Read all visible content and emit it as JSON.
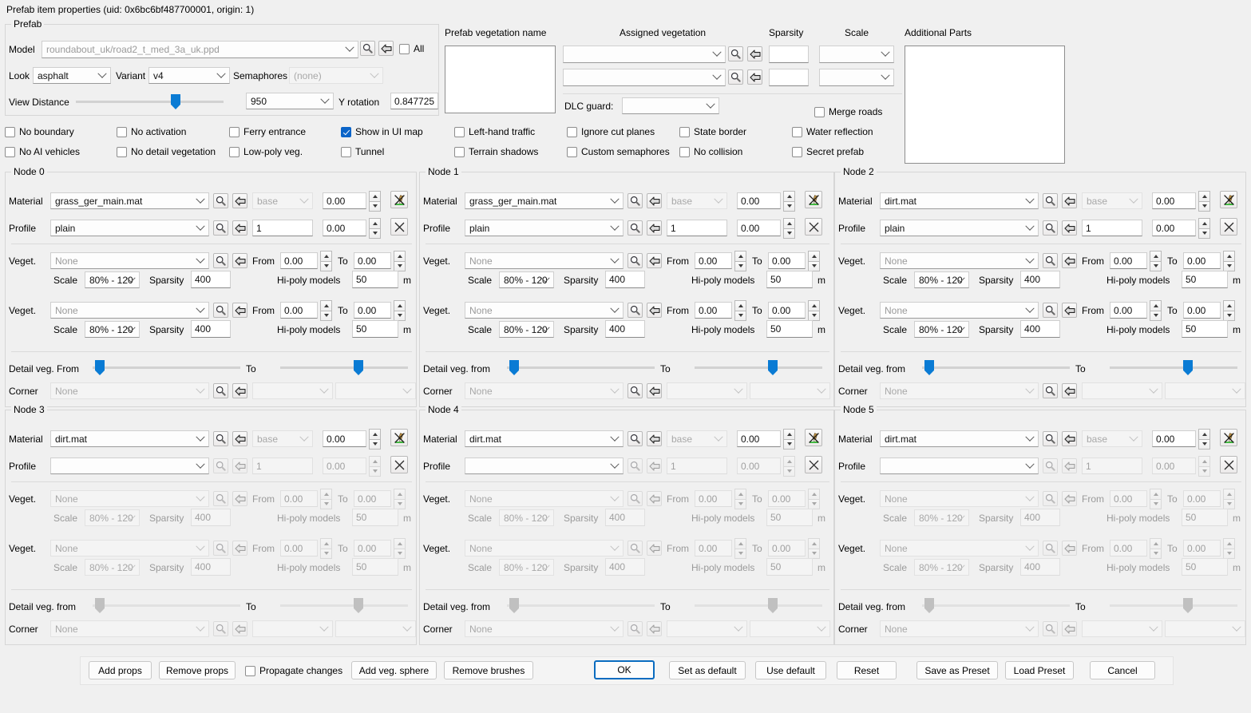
{
  "window": {
    "title": "Prefab item properties (uid: 0x6bc6bf487700001, origin: 1)"
  },
  "prefab": {
    "legend": "Prefab",
    "model_label": "Model",
    "model_value": "roundabout_uk/road2_t_med_3a_uk.ppd",
    "all_label": "All",
    "look_label": "Look",
    "look_value": "asphalt",
    "variant_label": "Variant",
    "variant_value": "v4",
    "semaphores_label": "Semaphores",
    "semaphores_value": "(none)",
    "view_distance_label": "View Distance",
    "view_distance_value": "950",
    "y_rotation_label": "Y rotation",
    "y_rotation_value": "0.847725",
    "checkboxes": [
      {
        "label": "No boundary",
        "checked": false
      },
      {
        "label": "No activation",
        "checked": false
      },
      {
        "label": "Ferry entrance",
        "checked": false
      },
      {
        "label": "Show in UI map",
        "checked": true
      },
      {
        "label": "No AI vehicles",
        "checked": false
      },
      {
        "label": "No detail vegetation",
        "checked": false
      },
      {
        "label": "Low-poly veg.",
        "checked": false
      },
      {
        "label": "Tunnel",
        "checked": false
      }
    ]
  },
  "vegetation_panel": {
    "prefab_vegetation_name_label": "Prefab vegetation name",
    "assigned_vegetation_label": "Assigned vegetation",
    "sparsity_label": "Sparsity",
    "scale_label": "Scale",
    "additional_parts_label": "Additional Parts",
    "rows": [
      {
        "assigned": "",
        "sparsity": "",
        "scale": ""
      },
      {
        "assigned": "",
        "sparsity": "",
        "scale": ""
      }
    ],
    "dlc_guard_label": "DLC guard:",
    "dlc_guard_value": "",
    "merge_roads": {
      "label": "Merge roads",
      "checked": false
    },
    "checkboxes": [
      {
        "label": "Left-hand traffic",
        "checked": false
      },
      {
        "label": "Ignore cut planes",
        "checked": false
      },
      {
        "label": "State border",
        "checked": false
      },
      {
        "label": "Water reflection",
        "checked": false
      },
      {
        "label": "Terrain shadows",
        "checked": false
      },
      {
        "label": "Custom semaphores",
        "checked": false
      },
      {
        "label": "No collision",
        "checked": false
      },
      {
        "label": "Secret prefab",
        "checked": false
      }
    ]
  },
  "node_labels": {
    "material": "Material",
    "profile": "Profile",
    "veget": "Veget.",
    "scale": "Scale",
    "sparsity": "Sparsity",
    "from": "From",
    "to": "To",
    "hipoly": "Hi-poly models",
    "meters": "m",
    "corner": "Corner",
    "detail_from_upper": "Detail veg. From",
    "detail_from_lower": "Detail veg. from",
    "detail_to": "To"
  },
  "nodes": [
    {
      "legend": "Node 0",
      "enabled": true,
      "detail_label": "Detail veg. From",
      "material": "grass_ger_main.mat",
      "material_variant": "base",
      "material_offset": "0.00",
      "profile": "plain",
      "profile_count": "1",
      "profile_offset": "0.00",
      "veg": [
        {
          "name": "None",
          "from": "0.00",
          "to": "0.00",
          "scale": "80% - 120",
          "sparsity": "400",
          "hipoly": "50"
        },
        {
          "name": "None",
          "from": "0.00",
          "to": "0.00",
          "scale": "80% - 120",
          "sparsity": "400",
          "hipoly": "50"
        }
      ],
      "corner": "None",
      "corner_opt1": "",
      "corner_opt2": ""
    },
    {
      "legend": "Node 1",
      "enabled": true,
      "detail_label": "Detail veg. from",
      "material": "grass_ger_main.mat",
      "material_variant": "base",
      "material_offset": "0.00",
      "profile": "plain",
      "profile_count": "1",
      "profile_offset": "0.00",
      "veg": [
        {
          "name": "None",
          "from": "0.00",
          "to": "0.00",
          "scale": "80% - 120",
          "sparsity": "400",
          "hipoly": "50"
        },
        {
          "name": "None",
          "from": "0.00",
          "to": "0.00",
          "scale": "80% - 120",
          "sparsity": "400",
          "hipoly": "50"
        }
      ],
      "corner": "None",
      "corner_opt1": "",
      "corner_opt2": ""
    },
    {
      "legend": "Node 2",
      "enabled": true,
      "detail_label": "Detail veg. from",
      "material": "dirt.mat",
      "material_variant": "base",
      "material_offset": "0.00",
      "profile": "plain",
      "profile_count": "1",
      "profile_offset": "0.00",
      "veg": [
        {
          "name": "None",
          "from": "0.00",
          "to": "0.00",
          "scale": "80% - 120",
          "sparsity": "400",
          "hipoly": "50"
        },
        {
          "name": "None",
          "from": "0.00",
          "to": "0.00",
          "scale": "80% - 120",
          "sparsity": "400",
          "hipoly": "50"
        }
      ],
      "corner": "None",
      "corner_opt1": "",
      "corner_opt2": ""
    },
    {
      "legend": "Node 3",
      "enabled": false,
      "detail_label": "Detail veg. from",
      "material": "dirt.mat",
      "material_variant": "base",
      "material_offset": "0.00",
      "profile": "",
      "profile_count": "1",
      "profile_offset": "0.00",
      "veg": [
        {
          "name": "None",
          "from": "0.00",
          "to": "0.00",
          "scale": "80% - 120",
          "sparsity": "400",
          "hipoly": "50"
        },
        {
          "name": "None",
          "from": "0.00",
          "to": "0.00",
          "scale": "80% - 120",
          "sparsity": "400",
          "hipoly": "50"
        }
      ],
      "corner": "None",
      "corner_opt1": "",
      "corner_opt2": ""
    },
    {
      "legend": "Node 4",
      "enabled": false,
      "detail_label": "Detail veg. from",
      "material": "dirt.mat",
      "material_variant": "base",
      "material_offset": "0.00",
      "profile": "",
      "profile_count": "1",
      "profile_offset": "0.00",
      "veg": [
        {
          "name": "None",
          "from": "0.00",
          "to": "0.00",
          "scale": "80% - 120",
          "sparsity": "400",
          "hipoly": "50"
        },
        {
          "name": "None",
          "from": "0.00",
          "to": "0.00",
          "scale": "80% - 120",
          "sparsity": "400",
          "hipoly": "50"
        }
      ],
      "corner": "None",
      "corner_opt1": "",
      "corner_opt2": ""
    },
    {
      "legend": "Node 5",
      "enabled": false,
      "detail_label": "Detail veg. from",
      "material": "dirt.mat",
      "material_variant": "base",
      "material_offset": "0.00",
      "profile": "",
      "profile_count": "1",
      "profile_offset": "0.00",
      "veg": [
        {
          "name": "None",
          "from": "0.00",
          "to": "0.00",
          "scale": "80% - 120",
          "sparsity": "400",
          "hipoly": "50"
        },
        {
          "name": "None",
          "from": "0.00",
          "to": "0.00",
          "scale": "80% - 120",
          "sparsity": "400",
          "hipoly": "50"
        }
      ],
      "corner": "None",
      "corner_opt1": "",
      "corner_opt2": ""
    }
  ],
  "footer": {
    "add_props": "Add props",
    "remove_props": "Remove props",
    "propagate_changes": "Propagate changes",
    "propagate_checked": false,
    "add_veg_sphere": "Add veg. sphere",
    "remove_brushes": "Remove brushes",
    "ok": "OK",
    "set_as_default": "Set as default",
    "use_default": "Use default",
    "reset": "Reset",
    "save_as_preset": "Save as Preset",
    "load_preset": "Load Preset",
    "cancel": "Cancel"
  },
  "colors": {
    "accent": "#0a64c8",
    "slider": "#0a7bd4",
    "window_bg": "#f0f0f0",
    "focus_border": "#0a6cc0"
  }
}
